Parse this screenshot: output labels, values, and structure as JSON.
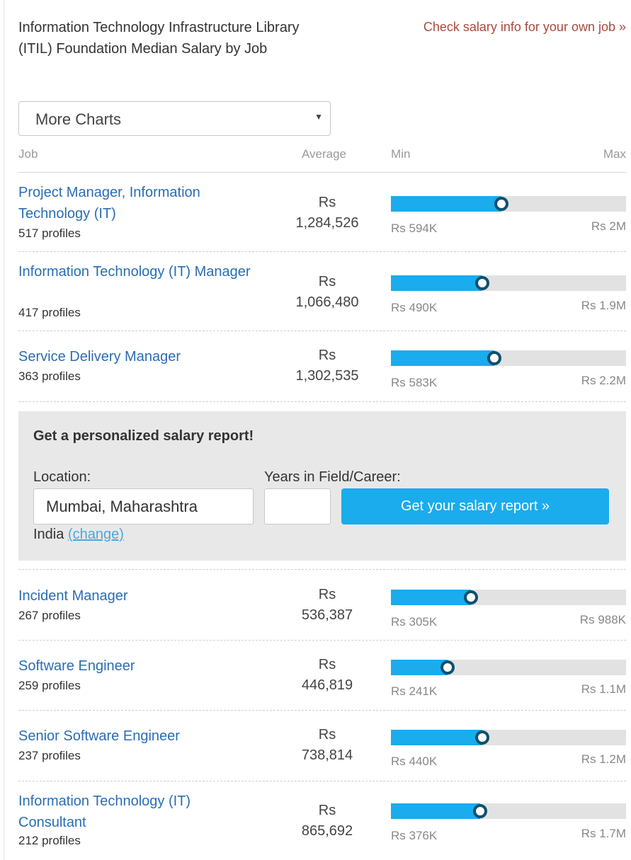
{
  "header": {
    "title": "Information Technology Infrastructure Library (ITIL) Foundation Median Salary by Job",
    "own_job_link": "Check salary info for your own job »"
  },
  "charts_select": {
    "value": "More Charts",
    "caret": "▼"
  },
  "columns": {
    "job": "Job",
    "average": "Average",
    "min": "Min",
    "max": "Max"
  },
  "jobs": [
    {
      "title": "Project Manager, Information Technology (IT)",
      "profiles": "517 profiles",
      "currency": "Rs",
      "average": "1,284,526",
      "min": "Rs 594K",
      "max": "Rs 2M",
      "position": 0.47
    },
    {
      "title": "Information Technology (IT) Manager",
      "profiles": "417 profiles",
      "currency": "Rs",
      "average": "1,066,480",
      "min": "Rs 490K",
      "max": "Rs 1.9M",
      "position": 0.39
    },
    {
      "title": "Service Delivery Manager",
      "profiles": "363 profiles",
      "currency": "Rs",
      "average": "1,302,535",
      "min": "Rs 583K",
      "max": "Rs 2.2M",
      "position": 0.44
    },
    {
      "title": "Incident Manager",
      "profiles": "267 profiles",
      "currency": "Rs",
      "average": "536,387",
      "min": "Rs 305K",
      "max": "Rs 988K",
      "position": 0.34
    },
    {
      "title": "Software Engineer",
      "profiles": "259 profiles",
      "currency": "Rs",
      "average": "446,819",
      "min": "Rs 241K",
      "max": "Rs 1.1M",
      "position": 0.24
    },
    {
      "title": "Senior Software Engineer",
      "profiles": "237 profiles",
      "currency": "Rs",
      "average": "738,814",
      "min": "Rs 440K",
      "max": "Rs 1.2M",
      "position": 0.39
    },
    {
      "title": "Information Technology (IT) Consultant",
      "profiles": "212 profiles",
      "currency": "Rs",
      "average": "865,692",
      "min": "Rs 376K",
      "max": "Rs 1.7M",
      "position": 0.38
    }
  ],
  "promo": {
    "title": "Get a personalized salary report!",
    "location_label": "Location:",
    "years_label": "Years in Field/Career:",
    "location_value": "Mumbai, Maharashtra",
    "years_value": "",
    "button": "Get your salary report »",
    "country": "India",
    "change_link": "(change)"
  },
  "colors": {
    "link": "#2a6db5",
    "bar": "#1aacec",
    "knob_border": "#10506e",
    "track": "#e2e2e2",
    "own_job_link": "#a84a3c"
  }
}
